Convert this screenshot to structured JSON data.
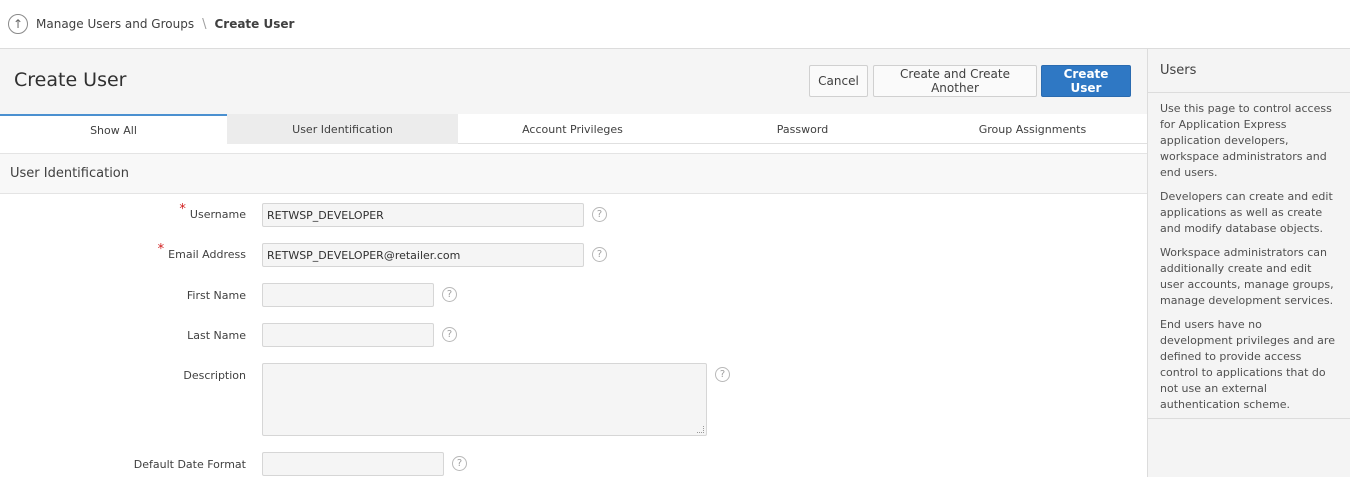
{
  "breadcrumb": {
    "parent": "Manage Users and Groups",
    "separator": "\\",
    "current": "Create User"
  },
  "header": {
    "title": "Create User",
    "cancel_label": "Cancel",
    "create_another_label": "Create and Create Another",
    "create_label": "Create User"
  },
  "tabs": [
    {
      "label": "Show All"
    },
    {
      "label": "User Identification"
    },
    {
      "label": "Account Privileges"
    },
    {
      "label": "Password"
    },
    {
      "label": "Group Assignments"
    }
  ],
  "region": {
    "title": "User Identification"
  },
  "form": {
    "required_mark": "*",
    "help_glyph": "?",
    "username": {
      "label": "Username",
      "value": "RETWSP_DEVELOPER",
      "required": true
    },
    "email": {
      "label": "Email Address",
      "value": "RETWSP_DEVELOPER@retailer.com",
      "required": true
    },
    "first_name": {
      "label": "First Name",
      "value": ""
    },
    "last_name": {
      "label": "Last Name",
      "value": ""
    },
    "description": {
      "label": "Description",
      "value": ""
    },
    "date_format": {
      "label": "Default Date Format",
      "value": ""
    }
  },
  "side_panel": {
    "title": "Users",
    "paragraphs": [
      "Use this page to control access for Application Express application developers, workspace administrators and end users.",
      "Developers can create and edit applications as well as create and modify database objects.",
      "Workspace administrators can additionally create and edit user accounts, manage groups, manage development services.",
      "End users have no development privileges and are defined to provide access control to applications that do not use an external authentication scheme."
    ]
  },
  "colors": {
    "primary_button": "#2f78c4",
    "required_asterisk": "#d01c1c",
    "active_tab_border": "#4a90d0"
  },
  "icons": {
    "breadcrumb_up": "arrow-up-circle-icon",
    "help": "question-circle-icon"
  }
}
